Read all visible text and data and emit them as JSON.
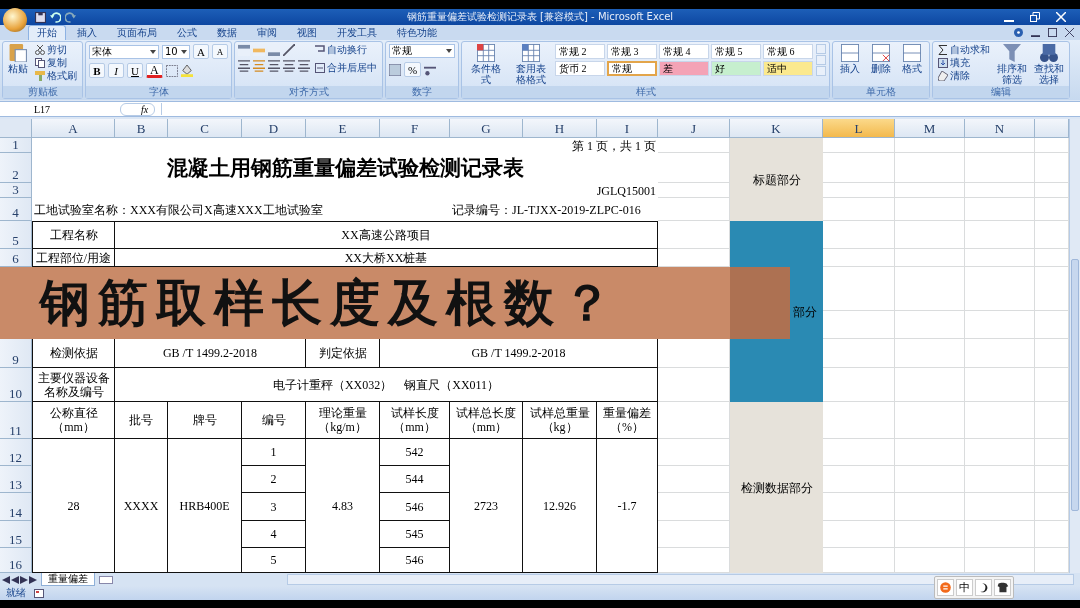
{
  "window": {
    "title": "钢筋重量偏差试验检测记录表 [兼容模式] - Microsoft Excel"
  },
  "ribbon": {
    "tabs": [
      {
        "label": "开始",
        "selected": true
      },
      {
        "label": "插入",
        "selected": false
      },
      {
        "label": "页面布局",
        "selected": false
      },
      {
        "label": "公式",
        "selected": false
      },
      {
        "label": "数据",
        "selected": false
      },
      {
        "label": "审阅",
        "selected": false
      },
      {
        "label": "视图",
        "selected": false
      },
      {
        "label": "开发工具",
        "selected": false
      },
      {
        "label": "特色功能",
        "selected": false
      }
    ],
    "groups": [
      {
        "kind": "clipboard",
        "label": "剪贴板",
        "big": "粘贴",
        "small": [
          "剪切",
          "复制",
          "格式刷"
        ]
      },
      {
        "kind": "font",
        "label": "字体",
        "font": "宋体",
        "size": "10",
        "buttons": [
          {
            "kind": "grow",
            "text": "A"
          },
          {
            "kind": "shrink",
            "text": "A"
          },
          {
            "kind": "bold",
            "text": "B"
          },
          {
            "kind": "italic",
            "text": "I"
          },
          {
            "kind": "underline",
            "text": "U"
          },
          {
            "kind": "color",
            "text": "A"
          }
        ]
      },
      {
        "kind": "alignment",
        "label": "对齐方式",
        "wrap": "自动换行",
        "merge": "合并后居中"
      },
      {
        "kind": "number",
        "label": "数字",
        "format": "常规",
        "percent": "%"
      },
      {
        "kind": "styles",
        "label": "样式",
        "big": [
          "条件格式",
          "套用表格格式"
        ],
        "cells": [
          {
            "text": "常规 2",
            "color": "#ffffff",
            "selected": false
          },
          {
            "text": "常规 3",
            "color": "#ffffff",
            "selected": false
          },
          {
            "text": "常规 4",
            "color": "#ffffff",
            "selected": false
          },
          {
            "text": "常规 5",
            "color": "#ffffff",
            "selected": false
          },
          {
            "text": "常规 6",
            "color": "#ffffff",
            "selected": false
          },
          {
            "text": "货币 2",
            "color": "#ffffff",
            "selected": false
          },
          {
            "text": "常规",
            "color": "#ffffff",
            "selected": true
          },
          {
            "text": "差",
            "color": "#f4a3b6",
            "selected": false
          },
          {
            "text": "好",
            "color": "#c6efce",
            "selected": false
          },
          {
            "text": "适中",
            "color": "#fbe98e",
            "selected": false
          }
        ]
      },
      {
        "kind": "cells",
        "label": "单元格",
        "buttons": [
          "插入",
          "删除",
          "格式"
        ]
      },
      {
        "kind": "editing",
        "label": "编辑",
        "small": [
          "自动求和",
          "填充",
          "清除"
        ],
        "big": [
          "排序和筛选",
          "查找和选择"
        ]
      }
    ]
  },
  "formula_bar": {
    "name_box": "L17",
    "fx": "fx"
  },
  "columns": [
    {
      "label": "A",
      "selected": false
    },
    {
      "label": "B",
      "selected": false
    },
    {
      "label": "C",
      "selected": false
    },
    {
      "label": "D",
      "selected": false
    },
    {
      "label": "E",
      "selected": false
    },
    {
      "label": "F",
      "selected": false
    },
    {
      "label": "G",
      "selected": false
    },
    {
      "label": "H",
      "selected": false
    },
    {
      "label": "I",
      "selected": false
    },
    {
      "label": "J",
      "selected": false
    },
    {
      "label": "K",
      "selected": false
    },
    {
      "label": "L",
      "selected": true
    },
    {
      "label": "M",
      "selected": false
    },
    {
      "label": "N",
      "selected": false
    }
  ],
  "rows": [
    "1",
    "2",
    "3",
    "4",
    "5",
    "6",
    "9",
    "10",
    "11",
    "12",
    "13",
    "14",
    "15",
    "16"
  ],
  "cells": [
    {
      "kind": "note",
      "text": "第 1 页，共 1 页"
    },
    {
      "kind": "title",
      "text": "混凝土用钢筋重量偏差试验检测记录表"
    },
    {
      "kind": "note",
      "text": "JGLQ15001"
    },
    {
      "kind": "label",
      "text": "工地试验室名称：XXX有限公司X高速XXX工地试验室"
    },
    {
      "kind": "label",
      "text": "记录编号：JL-TJXX-2019-ZLPC-016"
    },
    {
      "kind": "cell",
      "text": "工程名称"
    },
    {
      "kind": "cell",
      "text": "XX高速公路项目"
    },
    {
      "kind": "cell",
      "text": "工程部位/用途"
    },
    {
      "kind": "cell",
      "text": "XX大桥XX桩基"
    },
    {
      "kind": "cell",
      "text": "检测依据"
    },
    {
      "kind": "cell",
      "text": "GB /T 1499.2-2018"
    },
    {
      "kind": "cell",
      "text": "判定依据"
    },
    {
      "kind": "cell",
      "text": "GB /T 1499.2-2018"
    },
    {
      "kind": "cell",
      "text": "主要仪器设备名称及编号"
    },
    {
      "kind": "cell",
      "text": "电子计重秤（XX032）　钢直尺（XX011）"
    },
    {
      "kind": "cell",
      "text": "公称直径（mm）"
    },
    {
      "kind": "cell",
      "text": "批号"
    },
    {
      "kind": "cell",
      "text": "牌号"
    },
    {
      "kind": "cell",
      "text": "编号"
    },
    {
      "kind": "cell",
      "text": "理论重量（kg/m）"
    },
    {
      "kind": "cell",
      "text": "试样长度（mm）"
    },
    {
      "kind": "cell",
      "text": "试样总长度（mm）"
    },
    {
      "kind": "cell",
      "text": "试样总重量（kg）"
    },
    {
      "kind": "cell",
      "text": "重量偏差（%）"
    },
    {
      "kind": "cell",
      "text": "28"
    },
    {
      "kind": "cell",
      "text": "XXXX"
    },
    {
      "kind": "cell",
      "text": "HRB400E"
    },
    {
      "kind": "cell",
      "text": "1"
    },
    {
      "kind": "cell",
      "text": "2"
    },
    {
      "kind": "cell",
      "text": "3"
    },
    {
      "kind": "cell",
      "text": "4"
    },
    {
      "kind": "cell",
      "text": "5"
    },
    {
      "kind": "cell",
      "text": "4.83"
    },
    {
      "kind": "cell",
      "text": "542"
    },
    {
      "kind": "cell",
      "text": "544"
    },
    {
      "kind": "cell",
      "text": "546"
    },
    {
      "kind": "cell",
      "text": "545"
    },
    {
      "kind": "cell",
      "text": "546"
    },
    {
      "kind": "cell",
      "text": "2723"
    },
    {
      "kind": "cell",
      "text": "12.926"
    },
    {
      "kind": "cell",
      "text": "-1.7"
    },
    {
      "kind": "section",
      "text": "标题部分",
      "color": "#e6e2da"
    },
    {
      "kind": "section",
      "text": "部分",
      "color": "#2a8ab3"
    },
    {
      "kind": "section",
      "text": "检测数据部分",
      "color": "#e6e2da"
    }
  ],
  "caption": "钢筋取样长度及根数？",
  "sheet_tabs": [
    {
      "label": "重量偏差",
      "selected": true
    }
  ],
  "status_bar": {
    "text": "就绪"
  },
  "ime_toolbar": {
    "mode": "中"
  }
}
